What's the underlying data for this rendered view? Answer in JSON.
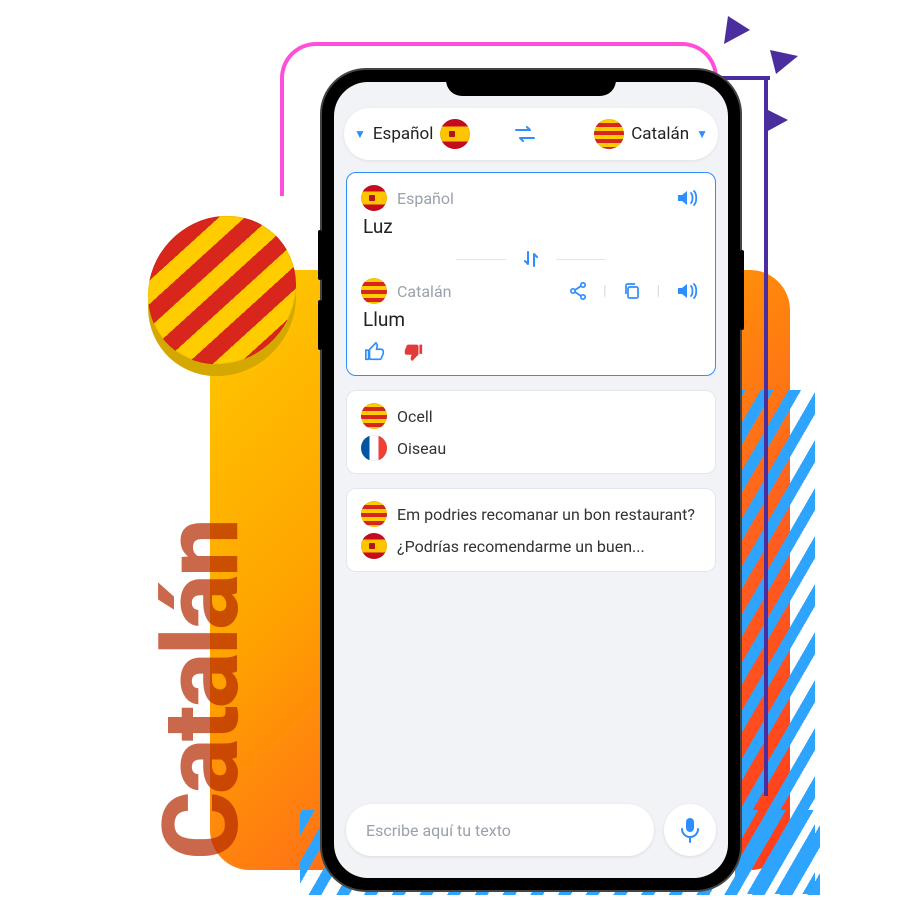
{
  "bg_text": "Catalán",
  "header": {
    "from": "Español",
    "to": "Catalán"
  },
  "main_card": {
    "from_label": "Español",
    "from_word": "Luz",
    "to_label": "Catalán",
    "to_word": "Llum"
  },
  "history": [
    {
      "a": "Ocell",
      "a_flag": "catalan",
      "b": "Oiseau",
      "b_flag": "france"
    },
    {
      "a": "Em podries recomanar un bon restaurant?",
      "a_flag": "catalan",
      "b": "¿Podrías recomendarme un buen...",
      "b_flag": "spain"
    }
  ],
  "input_placeholder": "Escribe aquí tu texto"
}
